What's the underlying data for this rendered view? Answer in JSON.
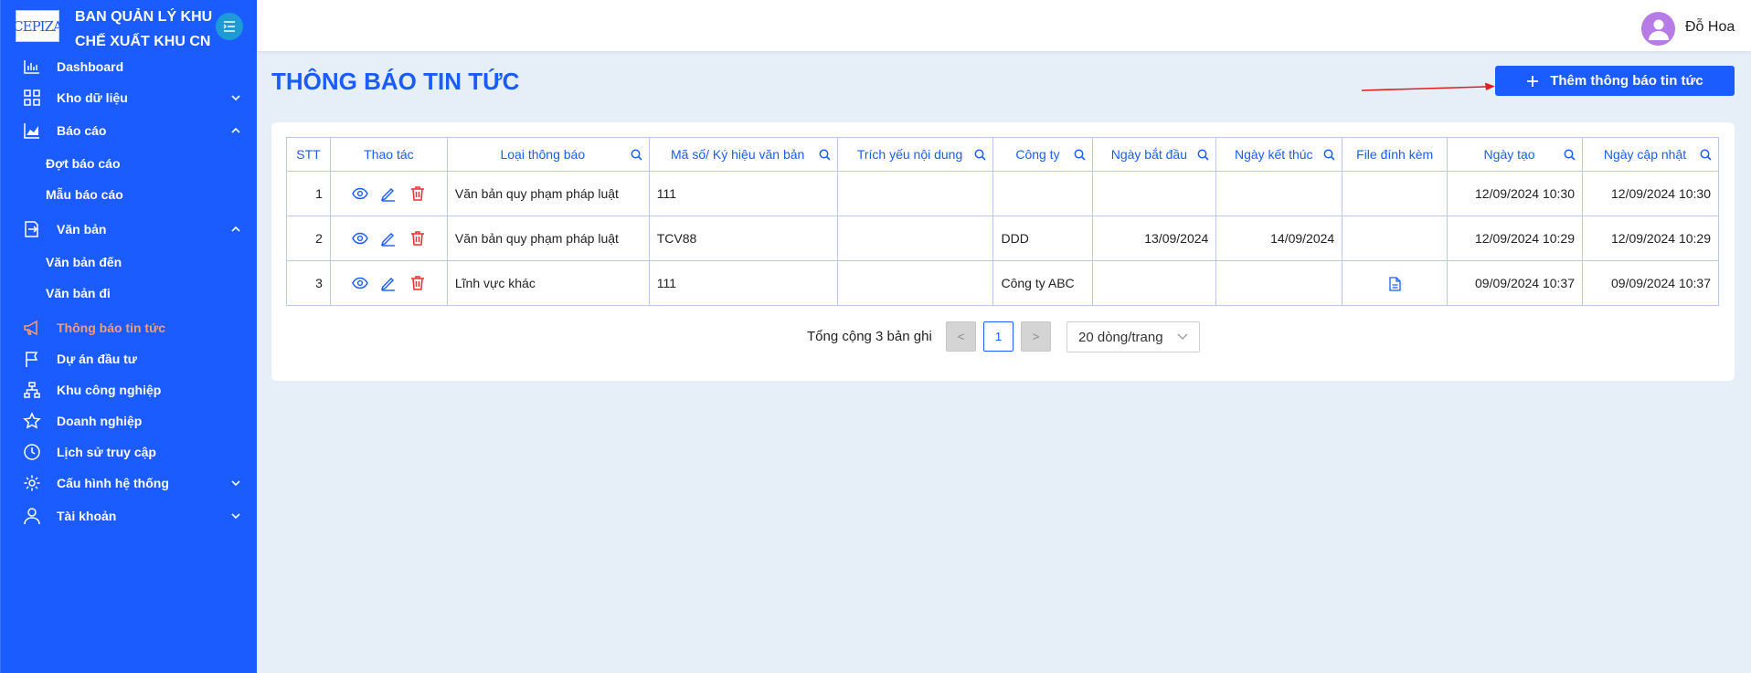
{
  "brand": {
    "logo_text": "CEPIZA",
    "name_line1": "BAN QUẢN LÝ KHU",
    "name_line2": "CHẾ XUẤT KHU CN"
  },
  "sidebar": {
    "items": [
      {
        "label": "Dashboard",
        "icon": "bar-chart-icon"
      },
      {
        "label": "Kho dữ liệu",
        "icon": "grid-icon",
        "expandable": true
      },
      {
        "label": "Báo cáo",
        "icon": "area-chart-icon",
        "expanded": true,
        "children": [
          "Đợt báo cáo",
          "Mẫu báo cáo"
        ]
      },
      {
        "label": "Văn bản",
        "icon": "document-arrow-icon",
        "expanded": true,
        "children": [
          "Văn bản đến",
          "Văn bản đi"
        ]
      },
      {
        "label": "Thông báo tin tức",
        "icon": "megaphone-icon",
        "active": true
      },
      {
        "label": "Dự án đầu tư",
        "icon": "flag-icon"
      },
      {
        "label": "Khu công nghiệp",
        "icon": "hierarchy-icon"
      },
      {
        "label": "Doanh nghiệp",
        "icon": "star-icon"
      },
      {
        "label": "Lịch sử truy cập",
        "icon": "clock-icon"
      },
      {
        "label": "Cấu hình hệ thống",
        "icon": "gear-icon",
        "expandable": true
      },
      {
        "label": "Tài khoản",
        "icon": "user-icon",
        "expandable": true
      }
    ],
    "active_color": "#ff9b6b"
  },
  "header": {
    "username": "Đỗ Hoa",
    "avatar_color": "#b77be6"
  },
  "page": {
    "title": "THÔNG BÁO TIN TỨC",
    "add_button": "Thêm thông báo tin tức"
  },
  "table": {
    "columns": [
      "STT",
      "Thao tác",
      "Loại thông báo",
      "Mã số/ Ký hiệu văn bản",
      "Trích yếu nội dung",
      "Công ty",
      "Ngày bắt đầu",
      "Ngày kết thúc",
      "File đính kèm",
      "Ngày tạo",
      "Ngày cập nhật"
    ],
    "rows": [
      {
        "stt": "1",
        "loai": "Văn bản quy phạm pháp luật",
        "ma_so": "111",
        "trich_yeu": "",
        "cong_ty": "",
        "ngay_bat_dau": "",
        "ngay_ket_thuc": "",
        "file": false,
        "ngay_tao": "12/09/2024 10:30",
        "ngay_cap_nhat": "12/09/2024 10:30"
      },
      {
        "stt": "2",
        "loai": "Văn bản quy phạm pháp luật",
        "ma_so": "TCV88",
        "trich_yeu": "",
        "cong_ty": "DDD",
        "ngay_bat_dau": "13/09/2024",
        "ngay_ket_thuc": "14/09/2024",
        "file": false,
        "ngay_tao": "12/09/2024 10:29",
        "ngay_cap_nhat": "12/09/2024 10:29"
      },
      {
        "stt": "3",
        "loai": "Lĩnh vực khác",
        "ma_so": "111",
        "trich_yeu": "",
        "cong_ty": "Công ty ABC",
        "ngay_bat_dau": "",
        "ngay_ket_thuc": "",
        "file": true,
        "ngay_tao": "09/09/2024 10:37",
        "ngay_cap_nhat": "09/09/2024 10:37"
      }
    ]
  },
  "pagination": {
    "total_text": "Tổng cộng 3 bản ghi",
    "prev": "<",
    "current_page": "1",
    "next": ">",
    "per_page": "20 dòng/trang"
  },
  "colors": {
    "primary": "#1a5cff",
    "delete": "#e8312f",
    "annotation_arrow": "#e02020"
  }
}
